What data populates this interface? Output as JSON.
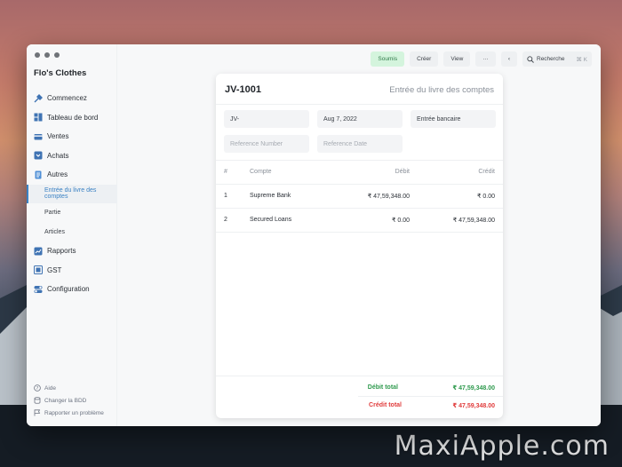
{
  "watermark": "MaxiApple.com",
  "app": {
    "brand": "Flo's Clothes"
  },
  "sidebar": {
    "items": [
      {
        "label": "Commencez",
        "icon": "tools-icon"
      },
      {
        "label": "Tableau de bord",
        "icon": "dashboard-icon"
      },
      {
        "label": "Ventes",
        "icon": "card-icon"
      },
      {
        "label": "Achats",
        "icon": "inbox-icon"
      },
      {
        "label": "Autres",
        "icon": "document-icon"
      }
    ],
    "sub_items": [
      {
        "label": "Entrée du livre des comptes",
        "active": true
      },
      {
        "label": "Partie",
        "active": false
      },
      {
        "label": "Articles",
        "active": false
      }
    ],
    "items_after": [
      {
        "label": "Rapports",
        "icon": "chart-icon"
      },
      {
        "label": "GST",
        "icon": "gst-icon"
      },
      {
        "label": "Configuration",
        "icon": "toggle-icon"
      }
    ],
    "footer": [
      {
        "label": "Aide",
        "icon": "help-icon"
      },
      {
        "label": "Changer la BDD",
        "icon": "database-icon"
      },
      {
        "label": "Rapporter un problème",
        "icon": "flag-icon"
      }
    ]
  },
  "toolbar": {
    "status": "Soumis",
    "create": "Créer",
    "view": "View",
    "more": "···",
    "back": "‹",
    "search_label": "Recherche",
    "search_shortcut": "⌘ K"
  },
  "document": {
    "title": "JV-1001",
    "type": "Entrée du livre des comptes",
    "number_series": "JV-",
    "date": "Aug 7, 2022",
    "entry_type": "Entrée bancaire",
    "reference_number_placeholder": "Reference Number",
    "reference_date_placeholder": "Reference Date",
    "table": {
      "headers": {
        "num": "#",
        "account": "Compte",
        "debit": "Débit",
        "credit": "Crédit"
      },
      "rows": [
        {
          "num": "1",
          "account": "Supreme Bank",
          "debit": "₹ 47,59,348.00",
          "credit": "₹ 0.00"
        },
        {
          "num": "2",
          "account": "Secured Loans",
          "debit": "₹ 0.00",
          "credit": "₹ 47,59,348.00"
        }
      ]
    },
    "totals": {
      "debit_label": "Débit total",
      "debit_value": "₹ 47,59,348.00",
      "credit_label": "Crédit total",
      "credit_value": "₹ 47,59,348.00"
    }
  }
}
